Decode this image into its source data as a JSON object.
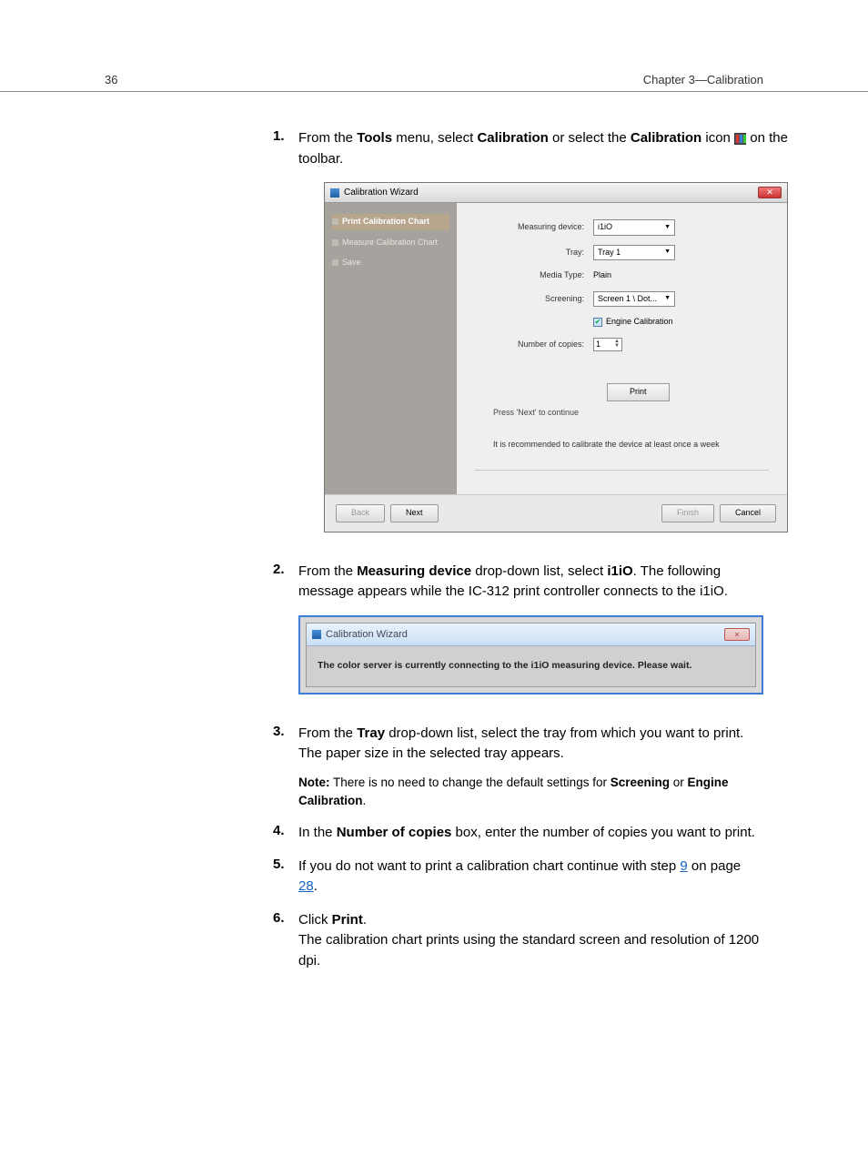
{
  "header": {
    "pageNumber": "36",
    "chapter": "Chapter 3—Calibration"
  },
  "steps": {
    "s1": {
      "num": "1.",
      "pre": "From the ",
      "tools": "Tools",
      "mid1": " menu, select ",
      "calibration": "Calibration",
      "mid2": " or select the ",
      "calibrationIcon": "Calibration",
      "mid3": " icon ",
      "post": " on the toolbar."
    },
    "s2": {
      "num": "2.",
      "pre": "From the ",
      "mdevice": "Measuring device",
      "mid": " drop-down list, select ",
      "i1io": "i1iO",
      "post": ". The following message appears while the IC-312 print controller connects to the i1iO."
    },
    "s3": {
      "num": "3.",
      "pre": "From the ",
      "tray": "Tray",
      "post": " drop-down list, select the tray from which you want to print.",
      "line2": "The paper size in the selected tray appears.",
      "noteLabel": "Note:",
      "noteBody1": " There is no need to change the default settings for ",
      "screening": "Screening",
      "noteBody2": " or ",
      "engine": "Engine Calibration",
      "noteBody3": "."
    },
    "s4": {
      "num": "4.",
      "pre": "In the ",
      "copies": "Number of copies",
      "post": " box, enter the number of copies you want to print."
    },
    "s5": {
      "num": "5.",
      "pre": "If you do not want to print a calibration chart continue with step ",
      "link9": "9",
      "mid": " on page ",
      "link28": "28",
      "post": "."
    },
    "s6": {
      "num": "6.",
      "pre": "Click ",
      "print": "Print",
      "post": ".",
      "line2": "The calibration chart prints using the standard screen and resolution of 1200 dpi."
    }
  },
  "wizard": {
    "title": "Calibration Wizard",
    "side": {
      "printChart": "Print Calibration Chart",
      "measureChart": "Measure Calibration Chart",
      "save": "Save"
    },
    "labels": {
      "measuringDevice": "Measuring device:",
      "tray": "Tray:",
      "mediaType": "Media Type:",
      "screening": "Screening:",
      "engineCal": "Engine Calibration",
      "numCopies": "Number of copies:"
    },
    "values": {
      "measuringDevice": "i1iO",
      "tray": "Tray 1",
      "mediaType": "Plain",
      "screening": "Screen 1 \\ Dot...",
      "numCopies": "1"
    },
    "printBtn": "Print",
    "hint": "Press 'Next' to continue",
    "recommendation": "It is recommended to calibrate the device at least once a week",
    "buttons": {
      "back": "Back",
      "next": "Next",
      "finish": "Finish",
      "cancel": "Cancel"
    }
  },
  "wizard2": {
    "title": "Calibration Wizard",
    "closeX": "×",
    "message": "The color server is currently connecting to the i1iO measuring device. Please wait."
  }
}
